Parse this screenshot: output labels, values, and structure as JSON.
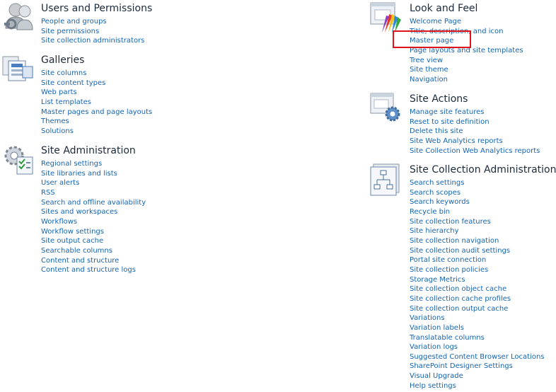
{
  "sections": {
    "users": {
      "title": "Users and Permissions",
      "links": [
        "People and groups",
        "Site permissions",
        "Site collection administrators"
      ]
    },
    "galleries": {
      "title": "Galleries",
      "links": [
        "Site columns",
        "Site content types",
        "Web parts",
        "List templates",
        "Master pages and page layouts",
        "Themes",
        "Solutions"
      ]
    },
    "site_admin": {
      "title": "Site Administration",
      "links": [
        "Regional settings",
        "Site libraries and lists",
        "User alerts",
        "RSS",
        "Search and offline availability",
        "Sites and workspaces",
        "Workflows",
        "Workflow settings",
        "Site output cache",
        "Searchable columns",
        "Content and structure",
        "Content and structure logs"
      ]
    },
    "look_feel": {
      "title": "Look and Feel",
      "links": [
        "Welcome Page",
        "Title, description, and icon",
        "Master page",
        "Page layouts and site templates",
        "Tree view",
        "Site theme",
        "Navigation"
      ]
    },
    "site_actions": {
      "title": "Site Actions",
      "links": [
        "Manage site features",
        "Reset to site definition",
        "Delete this site",
        "Site Web Analytics reports",
        "Site Collection Web Analytics reports"
      ]
    },
    "collection_admin": {
      "title": "Site Collection Administration",
      "links": [
        "Search settings",
        "Search scopes",
        "Search keywords",
        "Recycle bin",
        "Site collection features",
        "Site hierarchy",
        "Site collection navigation",
        "Site collection audit settings",
        "Portal site connection",
        "Site collection policies",
        "Storage Metrics",
        "Site collection object cache",
        "Site collection cache profiles",
        "Site collection output cache",
        "Variations",
        "Variation labels",
        "Translatable columns",
        "Variation logs",
        "Suggested Content Browser Locations",
        "SharePoint Designer Settings",
        "Visual Upgrade",
        "Help settings"
      ]
    }
  },
  "icons": {
    "users": "users-permissions-icon",
    "galleries": "galleries-icon",
    "site_admin": "site-administration-icon",
    "look_feel": "look-and-feel-icon",
    "site_actions": "site-actions-icon",
    "collection_admin": "site-collection-administration-icon"
  },
  "colors": {
    "link": "#1565b0",
    "heading": "#1c2a3a",
    "highlight": "#e0121b"
  }
}
